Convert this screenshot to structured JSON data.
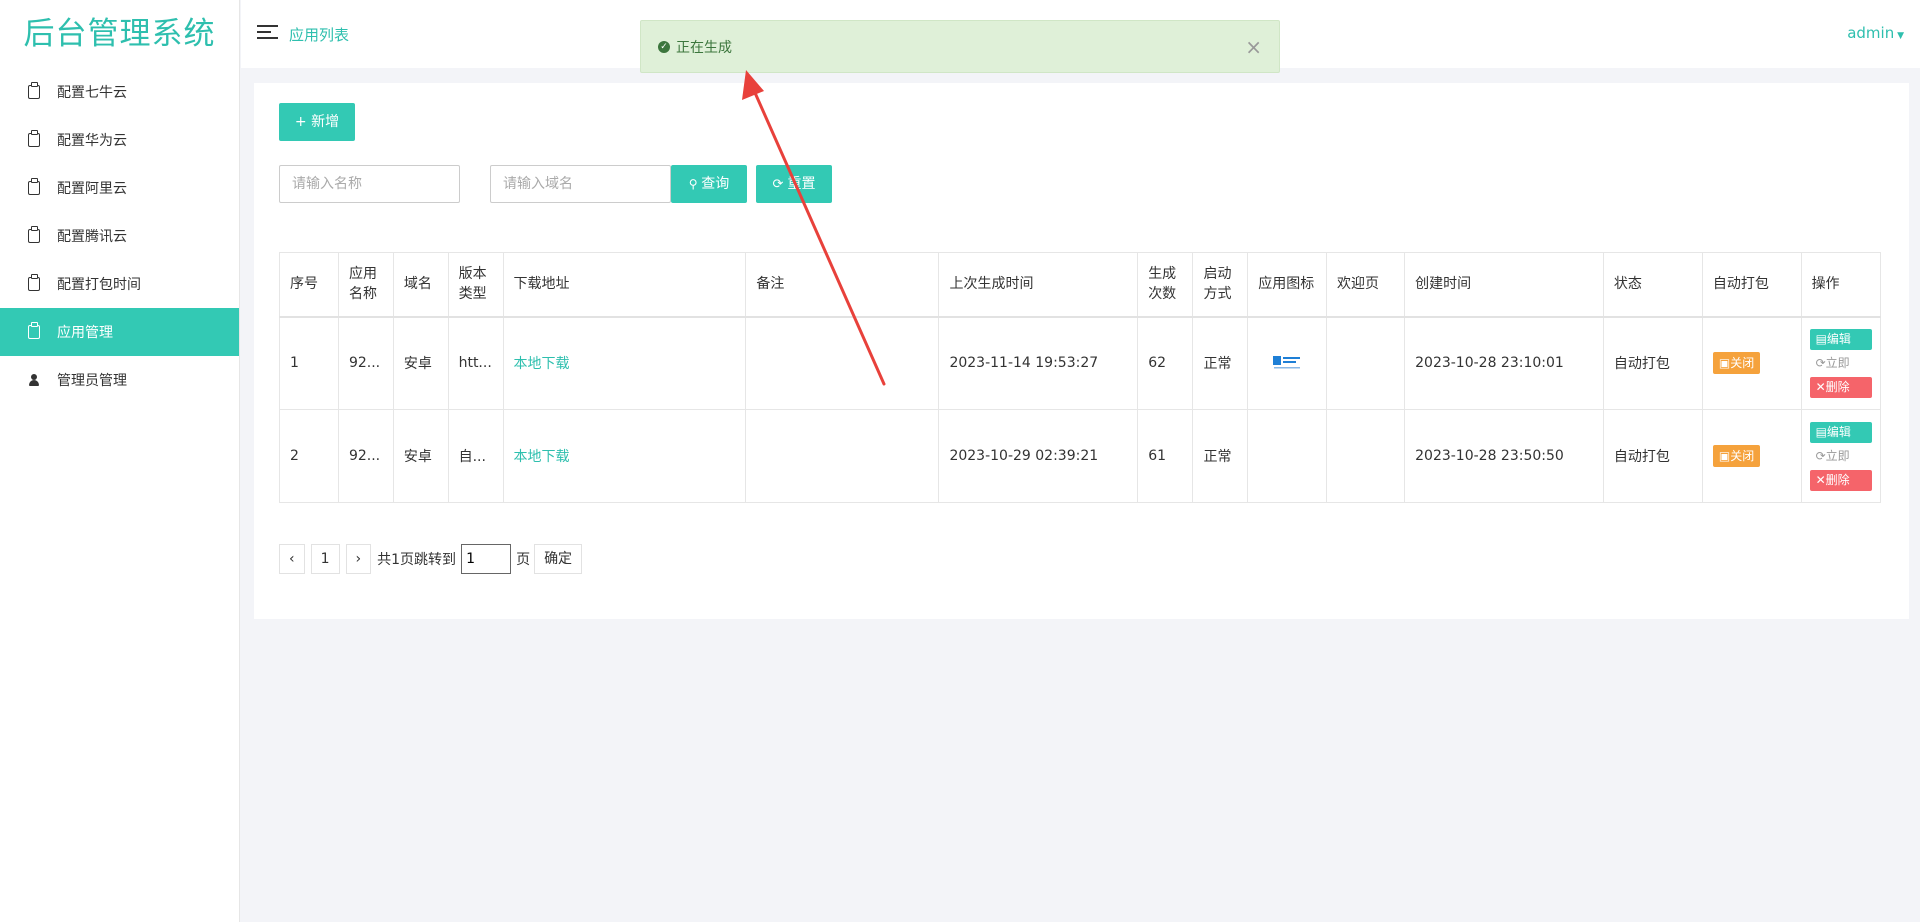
{
  "brand": "后台管理系统",
  "sidebar": {
    "items": [
      {
        "label": "配置七牛云"
      },
      {
        "label": "配置华为云"
      },
      {
        "label": "配置阿里云"
      },
      {
        "label": "配置腾讯云"
      },
      {
        "label": "配置打包时间"
      },
      {
        "label": "应用管理",
        "active": true
      },
      {
        "label": "管理员管理"
      }
    ]
  },
  "header": {
    "title": "应用列表",
    "user": "admin"
  },
  "toast": {
    "message": "正在生成",
    "close": "×"
  },
  "toolbar": {
    "add_label": "+ 新增",
    "name_placeholder": "请输入名称",
    "domain_placeholder": "请输入域名",
    "search_label": "查询",
    "reset_label": "重置"
  },
  "table": {
    "headers": [
      "序号",
      "应用名称",
      "域名",
      "版本类型",
      "下载地址",
      "备注",
      "上次生成时间",
      "生成次数",
      "启动方式",
      "应用图标",
      "欢迎页",
      "创建时间",
      "状态",
      "自动打包",
      "操作"
    ],
    "rows": [
      {
        "index": "1",
        "name": "92...",
        "domain": "安卓",
        "version": "htt...",
        "download": "本地下载",
        "remark": "",
        "last_gen": "2023-11-14 19:53:27",
        "count": "62",
        "launch": "正常",
        "welcome": "",
        "created": "2023-10-28 23:10:01",
        "status": "自动打包",
        "auto": "关闭",
        "ops": {
          "edit": "编辑",
          "now": "立即",
          "del": "删除"
        },
        "has_icon": true
      },
      {
        "index": "2",
        "name": "92...",
        "domain": "安卓",
        "version": "自...",
        "download": "本地下载",
        "remark": "",
        "last_gen": "2023-10-29 02:39:21",
        "count": "61",
        "launch": "正常",
        "welcome": "",
        "created": "2023-10-28 23:50:50",
        "status": "自动打包",
        "auto": "关闭",
        "ops": {
          "edit": "编辑",
          "now": "立即",
          "del": "删除"
        },
        "has_icon": false
      }
    ]
  },
  "pagination": {
    "prev": "‹",
    "page": "1",
    "next": "›",
    "info": "共1页跳转到",
    "jump_value": "1",
    "unit": "页",
    "confirm": "确定"
  },
  "colors": {
    "accent": "#33c9b4",
    "success_bg": "#dff0d8",
    "warning": "#f5a23c",
    "danger": "#f5646a",
    "arrow": "#e8413b"
  }
}
